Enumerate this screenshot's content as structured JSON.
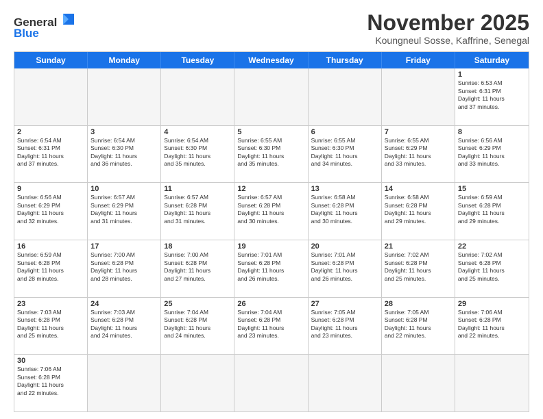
{
  "logo": {
    "text_general": "General",
    "text_blue": "Blue"
  },
  "title": {
    "month_year": "November 2025",
    "location": "Koungneul Sosse, Kaffrine, Senegal"
  },
  "header_days": [
    "Sunday",
    "Monday",
    "Tuesday",
    "Wednesday",
    "Thursday",
    "Friday",
    "Saturday"
  ],
  "weeks": [
    [
      {
        "day": "",
        "info": "",
        "empty": true
      },
      {
        "day": "",
        "info": "",
        "empty": true
      },
      {
        "day": "",
        "info": "",
        "empty": true
      },
      {
        "day": "",
        "info": "",
        "empty": true
      },
      {
        "day": "",
        "info": "",
        "empty": true
      },
      {
        "day": "",
        "info": "",
        "empty": true
      },
      {
        "day": "1",
        "info": "Sunrise: 6:53 AM\nSunset: 6:31 PM\nDaylight: 11 hours\nand 37 minutes.",
        "empty": false
      }
    ],
    [
      {
        "day": "2",
        "info": "Sunrise: 6:54 AM\nSunset: 6:31 PM\nDaylight: 11 hours\nand 37 minutes.",
        "empty": false
      },
      {
        "day": "3",
        "info": "Sunrise: 6:54 AM\nSunset: 6:30 PM\nDaylight: 11 hours\nand 36 minutes.",
        "empty": false
      },
      {
        "day": "4",
        "info": "Sunrise: 6:54 AM\nSunset: 6:30 PM\nDaylight: 11 hours\nand 35 minutes.",
        "empty": false
      },
      {
        "day": "5",
        "info": "Sunrise: 6:55 AM\nSunset: 6:30 PM\nDaylight: 11 hours\nand 35 minutes.",
        "empty": false
      },
      {
        "day": "6",
        "info": "Sunrise: 6:55 AM\nSunset: 6:30 PM\nDaylight: 11 hours\nand 34 minutes.",
        "empty": false
      },
      {
        "day": "7",
        "info": "Sunrise: 6:55 AM\nSunset: 6:29 PM\nDaylight: 11 hours\nand 33 minutes.",
        "empty": false
      },
      {
        "day": "8",
        "info": "Sunrise: 6:56 AM\nSunset: 6:29 PM\nDaylight: 11 hours\nand 33 minutes.",
        "empty": false
      }
    ],
    [
      {
        "day": "9",
        "info": "Sunrise: 6:56 AM\nSunset: 6:29 PM\nDaylight: 11 hours\nand 32 minutes.",
        "empty": false
      },
      {
        "day": "10",
        "info": "Sunrise: 6:57 AM\nSunset: 6:29 PM\nDaylight: 11 hours\nand 31 minutes.",
        "empty": false
      },
      {
        "day": "11",
        "info": "Sunrise: 6:57 AM\nSunset: 6:28 PM\nDaylight: 11 hours\nand 31 minutes.",
        "empty": false
      },
      {
        "day": "12",
        "info": "Sunrise: 6:57 AM\nSunset: 6:28 PM\nDaylight: 11 hours\nand 30 minutes.",
        "empty": false
      },
      {
        "day": "13",
        "info": "Sunrise: 6:58 AM\nSunset: 6:28 PM\nDaylight: 11 hours\nand 30 minutes.",
        "empty": false
      },
      {
        "day": "14",
        "info": "Sunrise: 6:58 AM\nSunset: 6:28 PM\nDaylight: 11 hours\nand 29 minutes.",
        "empty": false
      },
      {
        "day": "15",
        "info": "Sunrise: 6:59 AM\nSunset: 6:28 PM\nDaylight: 11 hours\nand 29 minutes.",
        "empty": false
      }
    ],
    [
      {
        "day": "16",
        "info": "Sunrise: 6:59 AM\nSunset: 6:28 PM\nDaylight: 11 hours\nand 28 minutes.",
        "empty": false
      },
      {
        "day": "17",
        "info": "Sunrise: 7:00 AM\nSunset: 6:28 PM\nDaylight: 11 hours\nand 28 minutes.",
        "empty": false
      },
      {
        "day": "18",
        "info": "Sunrise: 7:00 AM\nSunset: 6:28 PM\nDaylight: 11 hours\nand 27 minutes.",
        "empty": false
      },
      {
        "day": "19",
        "info": "Sunrise: 7:01 AM\nSunset: 6:28 PM\nDaylight: 11 hours\nand 26 minutes.",
        "empty": false
      },
      {
        "day": "20",
        "info": "Sunrise: 7:01 AM\nSunset: 6:28 PM\nDaylight: 11 hours\nand 26 minutes.",
        "empty": false
      },
      {
        "day": "21",
        "info": "Sunrise: 7:02 AM\nSunset: 6:28 PM\nDaylight: 11 hours\nand 25 minutes.",
        "empty": false
      },
      {
        "day": "22",
        "info": "Sunrise: 7:02 AM\nSunset: 6:28 PM\nDaylight: 11 hours\nand 25 minutes.",
        "empty": false
      }
    ],
    [
      {
        "day": "23",
        "info": "Sunrise: 7:03 AM\nSunset: 6:28 PM\nDaylight: 11 hours\nand 25 minutes.",
        "empty": false
      },
      {
        "day": "24",
        "info": "Sunrise: 7:03 AM\nSunset: 6:28 PM\nDaylight: 11 hours\nand 24 minutes.",
        "empty": false
      },
      {
        "day": "25",
        "info": "Sunrise: 7:04 AM\nSunset: 6:28 PM\nDaylight: 11 hours\nand 24 minutes.",
        "empty": false
      },
      {
        "day": "26",
        "info": "Sunrise: 7:04 AM\nSunset: 6:28 PM\nDaylight: 11 hours\nand 23 minutes.",
        "empty": false
      },
      {
        "day": "27",
        "info": "Sunrise: 7:05 AM\nSunset: 6:28 PM\nDaylight: 11 hours\nand 23 minutes.",
        "empty": false
      },
      {
        "day": "28",
        "info": "Sunrise: 7:05 AM\nSunset: 6:28 PM\nDaylight: 11 hours\nand 22 minutes.",
        "empty": false
      },
      {
        "day": "29",
        "info": "Sunrise: 7:06 AM\nSunset: 6:28 PM\nDaylight: 11 hours\nand 22 minutes.",
        "empty": false
      }
    ],
    [
      {
        "day": "30",
        "info": "Sunrise: 7:06 AM\nSunset: 6:28 PM\nDaylight: 11 hours\nand 22 minutes.",
        "empty": false
      },
      {
        "day": "",
        "info": "",
        "empty": true
      },
      {
        "day": "",
        "info": "",
        "empty": true
      },
      {
        "day": "",
        "info": "",
        "empty": true
      },
      {
        "day": "",
        "info": "",
        "empty": true
      },
      {
        "day": "",
        "info": "",
        "empty": true
      },
      {
        "day": "",
        "info": "",
        "empty": true
      }
    ]
  ]
}
